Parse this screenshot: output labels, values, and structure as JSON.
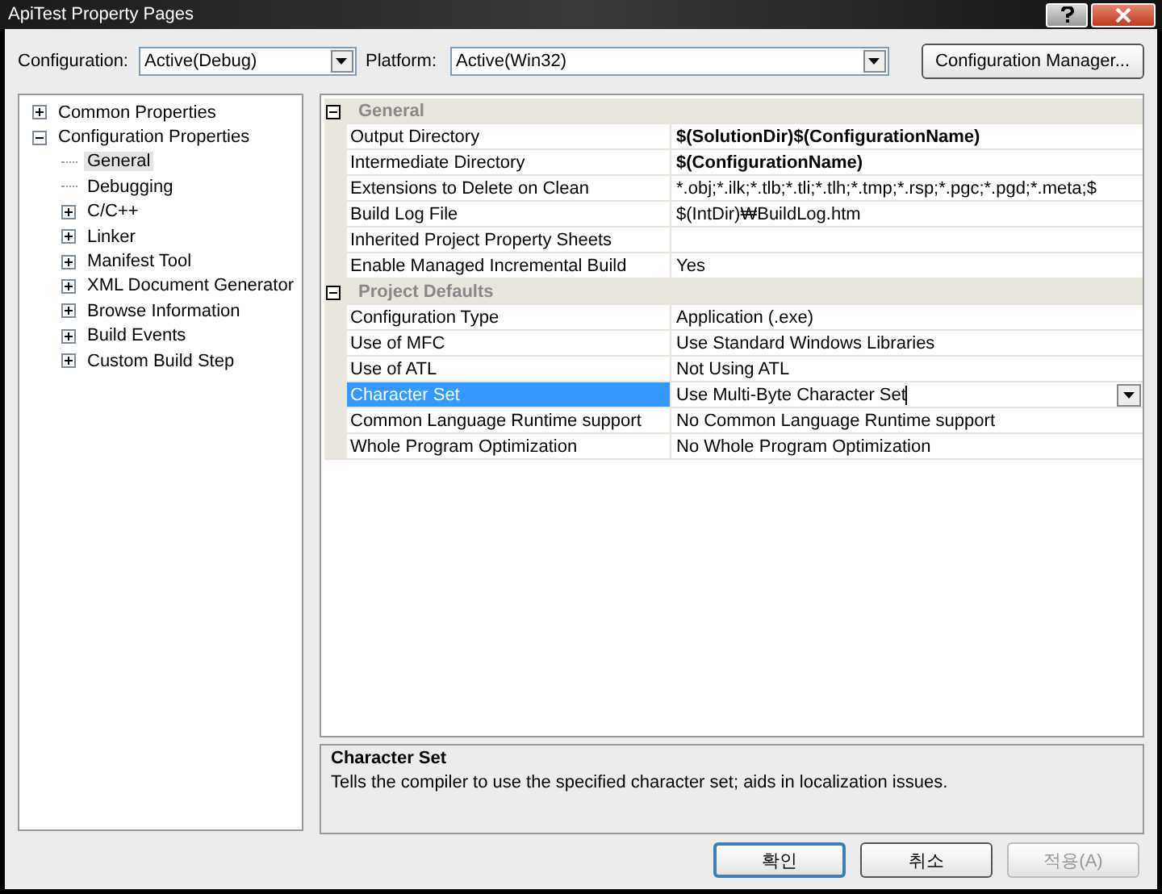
{
  "window": {
    "title": "ApiTest Property Pages"
  },
  "toolbar": {
    "configuration_label": "Configuration:",
    "configuration": "Active(Debug)",
    "platform_label": "Platform:",
    "platform": "Active(Win32)",
    "manager_button": "Configuration Manager..."
  },
  "tree": [
    {
      "label": "Common Properties",
      "kind": "folder",
      "expanded": false,
      "selected": false
    },
    {
      "label": "Configuration Properties",
      "kind": "folder",
      "expanded": true,
      "selected": false,
      "children": [
        {
          "label": "General",
          "kind": "leaf",
          "selected": true
        },
        {
          "label": "Debugging",
          "kind": "leaf",
          "selected": false
        },
        {
          "label": "C/C++",
          "kind": "folder",
          "expanded": false,
          "selected": false
        },
        {
          "label": "Linker",
          "kind": "folder",
          "expanded": false,
          "selected": false
        },
        {
          "label": "Manifest Tool",
          "kind": "folder",
          "expanded": false,
          "selected": false
        },
        {
          "label": "XML Document Generator",
          "kind": "folder",
          "expanded": false,
          "selected": false
        },
        {
          "label": "Browse Information",
          "kind": "folder",
          "expanded": false,
          "selected": false
        },
        {
          "label": "Build Events",
          "kind": "folder",
          "expanded": false,
          "selected": false
        },
        {
          "label": "Custom Build Step",
          "kind": "folder",
          "expanded": false,
          "selected": false
        }
      ]
    }
  ],
  "grid": [
    {
      "name": "General",
      "expanded": true,
      "properties": [
        {
          "name": "Output Directory",
          "value": "$(SolutionDir)$(ConfigurationName)",
          "modified": true,
          "selected": false
        },
        {
          "name": "Intermediate Directory",
          "value": "$(ConfigurationName)",
          "modified": true,
          "selected": false
        },
        {
          "name": "Extensions to Delete on Clean",
          "value": "*.obj;*.ilk;*.tlb;*.tli;*.tlh;*.tmp;*.rsp;*.pgc;*.pgd;*.meta;$",
          "modified": false,
          "selected": false
        },
        {
          "name": "Build Log File",
          "value": "$(IntDir)₩BuildLog.htm",
          "modified": false,
          "selected": false
        },
        {
          "name": "Inherited Project Property Sheets",
          "modified": false,
          "selected": false
        },
        {
          "name": "Enable Managed Incremental Build",
          "value": "Yes",
          "modified": false,
          "selected": false
        }
      ]
    },
    {
      "name": "Project Defaults",
      "expanded": true,
      "properties": [
        {
          "name": "Configuration Type",
          "value": "Application (.exe)",
          "modified": false,
          "selected": false
        },
        {
          "name": "Use of MFC",
          "value": "Use Standard Windows Libraries",
          "modified": false,
          "selected": false
        },
        {
          "name": "Use of ATL",
          "value": "Not Using ATL",
          "modified": false,
          "selected": false
        },
        {
          "name": "Character Set",
          "value": "Use Multi-Byte Character Set",
          "modified": false,
          "selected": true
        },
        {
          "name": "Common Language Runtime support",
          "value": "No Common Language Runtime support",
          "modified": false,
          "selected": false
        },
        {
          "name": "Whole Program Optimization",
          "value": "No Whole Program Optimization",
          "modified": false,
          "selected": false
        }
      ]
    }
  ],
  "description": {
    "title": "Character Set",
    "text": "Tells the compiler to use the specified character set; aids in localization issues."
  },
  "buttons": [
    {
      "label": "확인",
      "kind": "default",
      "disabled": false
    },
    {
      "label": "취소",
      "kind": "normal",
      "disabled": false
    },
    {
      "label": "적용(A)",
      "kind": "normal",
      "disabled": true
    }
  ]
}
